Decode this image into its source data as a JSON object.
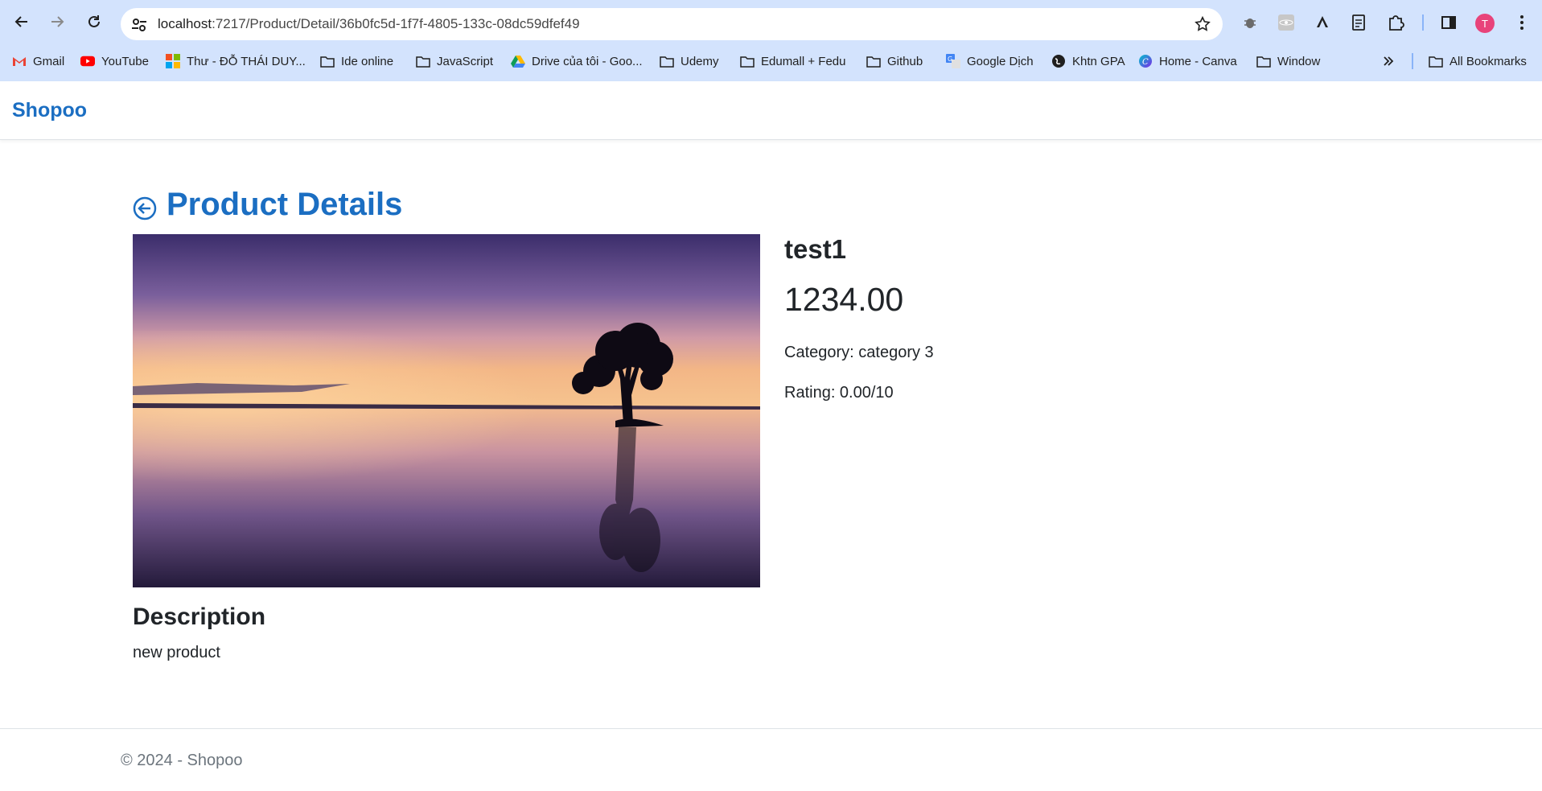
{
  "browser": {
    "url_host": "localhost",
    "url_path": ":7217/Product/Detail/36b0fc5d-1f7f-4805-133c-08dc59dfef49",
    "profile_initial": "T",
    "bookmarks": [
      {
        "label": "Gmail",
        "icon": "gmail-icon"
      },
      {
        "label": "YouTube",
        "icon": "youtube-icon"
      },
      {
        "label": "Thư - ĐỖ THÁI DUY...",
        "icon": "microsoft-icon"
      },
      {
        "label": "Ide online",
        "icon": "folder-icon"
      },
      {
        "label": "JavaScript",
        "icon": "folder-icon"
      },
      {
        "label": "Drive của tôi - Goo...",
        "icon": "drive-icon"
      },
      {
        "label": "Udemy",
        "icon": "folder-icon"
      },
      {
        "label": "Edumall + Fedu",
        "icon": "folder-icon"
      },
      {
        "label": "Github",
        "icon": "folder-icon"
      },
      {
        "label": "Google Dịch",
        "icon": "translate-icon"
      },
      {
        "label": "Khtn GPA",
        "icon": "globe-icon"
      },
      {
        "label": "Home - Canva",
        "icon": "canva-icon"
      },
      {
        "label": "Window",
        "icon": "folder-icon"
      }
    ],
    "all_bookmarks": "All Bookmarks"
  },
  "site": {
    "brand": "Shopoo"
  },
  "page": {
    "title": "Product Details",
    "product": {
      "name": "test1",
      "price": "1234.00",
      "category": "Category: category 3",
      "rating": "Rating: 0.00/10"
    },
    "description_heading": "Description",
    "description_text": "new product"
  },
  "footer": {
    "text": "© 2024 - Shopoo"
  },
  "colors": {
    "brand": "#1b6ec2",
    "chrome_bg": "#d3e3fd"
  }
}
